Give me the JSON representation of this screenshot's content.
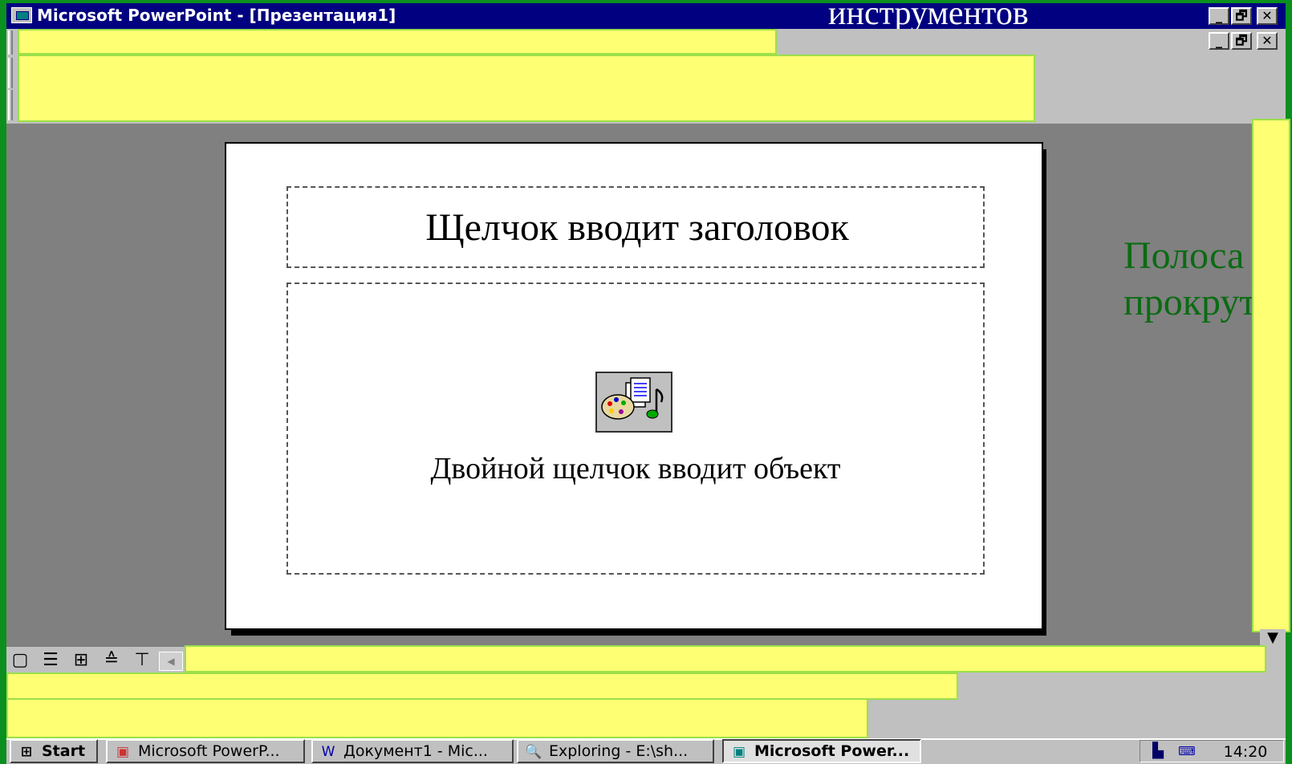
{
  "window": {
    "title": "Microsoft PowerPoint - [Презентация1]",
    "controls": [
      "_",
      "🗗",
      "✕"
    ]
  },
  "document_controls": [
    "_",
    "🗗",
    "✕"
  ],
  "annotations": {
    "top_label": "инструментов",
    "scroll_label_line1": "Полоса",
    "scroll_label_line2": "прокрутки"
  },
  "slide": {
    "title_placeholder": "Щелчок вводит заголовок",
    "body_placeholder": "Двойной щелчок вводит объект"
  },
  "view_buttons": [
    "▢",
    "☰",
    "⊞",
    "≙",
    "⊤"
  ],
  "taskbar": {
    "start": "Start",
    "items": [
      {
        "label": "Microsoft PowerP..."
      },
      {
        "label": "Документ1 - Mic..."
      },
      {
        "label": "Exploring - E:\\sh..."
      },
      {
        "label": "Microsoft Power..."
      }
    ],
    "clock": "14:20"
  },
  "colors": {
    "highlight_yellow": "#ffff73",
    "slide_bg": "#ffffff",
    "workspace_gray": "#808080",
    "frame_green": "#0b8f1e"
  }
}
